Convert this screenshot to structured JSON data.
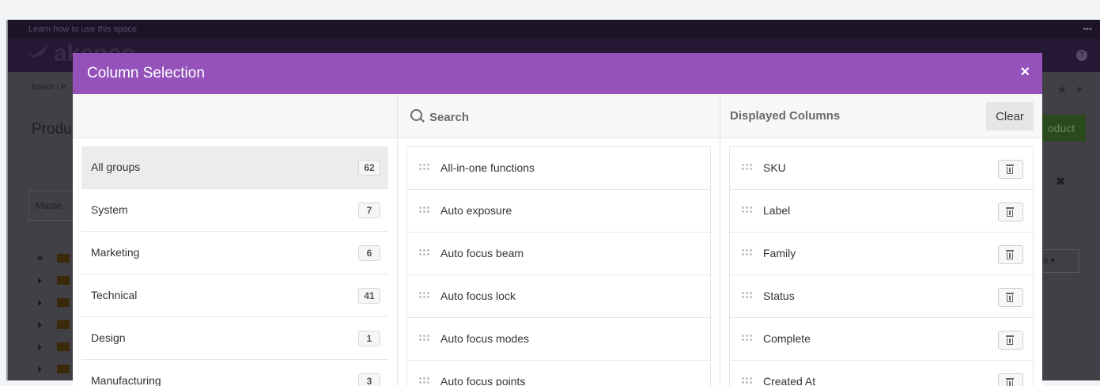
{
  "app": {
    "helpbar_text": "Learn how to use this space",
    "helpbar_dots": "•••",
    "logo_text": "akeneo",
    "breadcrumb": "Enrich / P",
    "page_title": "Produ",
    "create_button": "oduct",
    "master_label": "Maste",
    "select_label": "ce ▾",
    "help_icon": "?",
    "close_x": "✖"
  },
  "modal": {
    "title": "Column Selection",
    "close_label": "×",
    "search_placeholder": "Search",
    "displayed_title": "Displayed Columns",
    "clear_label": "Clear"
  },
  "groups": [
    {
      "label": "All groups",
      "count": "62",
      "active": true
    },
    {
      "label": "System",
      "count": "7"
    },
    {
      "label": "Marketing",
      "count": "6"
    },
    {
      "label": "Technical",
      "count": "41"
    },
    {
      "label": "Design",
      "count": "1"
    },
    {
      "label": "Manufacturing",
      "count": "3"
    }
  ],
  "attributes": [
    {
      "label": "All-in-one functions"
    },
    {
      "label": "Auto exposure"
    },
    {
      "label": "Auto focus beam"
    },
    {
      "label": "Auto focus lock"
    },
    {
      "label": "Auto focus modes"
    },
    {
      "label": "Auto focus points"
    }
  ],
  "displayed": [
    {
      "label": "SKU"
    },
    {
      "label": "Label"
    },
    {
      "label": "Family"
    },
    {
      "label": "Status"
    },
    {
      "label": "Complete"
    },
    {
      "label": "Created At"
    }
  ],
  "icons": {
    "search": "search-icon",
    "grip": "drag-handle-icon",
    "trash": "trash-icon",
    "close": "close-icon"
  },
  "colors": {
    "modal_header": "#9452ba",
    "active_group": "#ececec"
  }
}
